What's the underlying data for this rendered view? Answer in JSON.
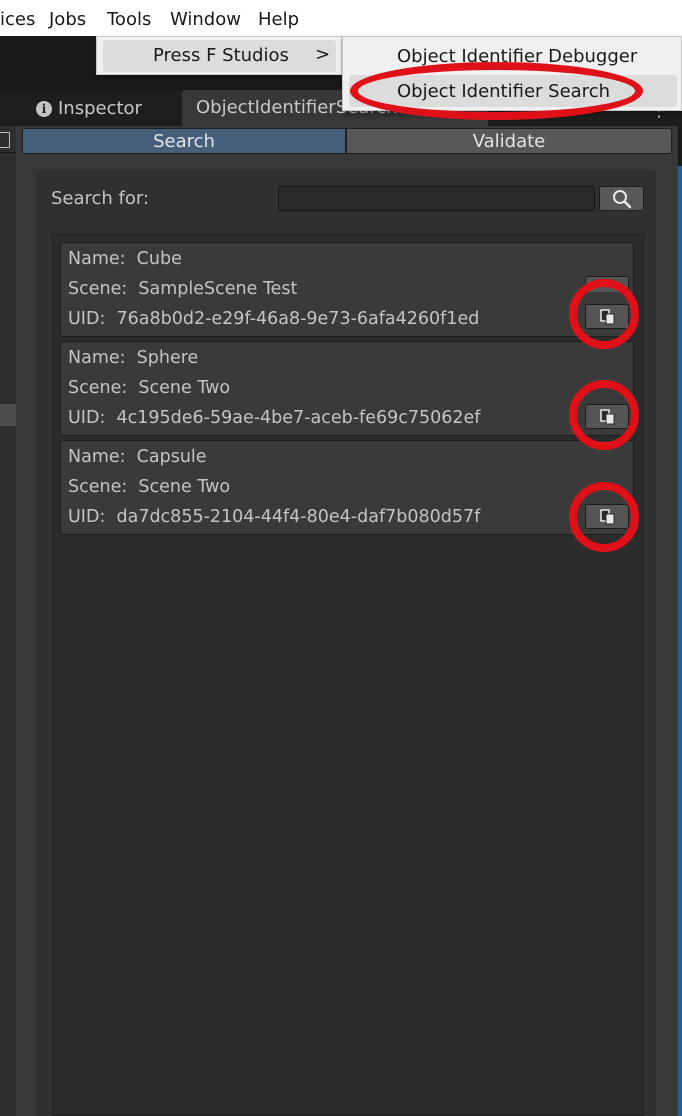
{
  "menubar": {
    "items": [
      "ices",
      "Jobs",
      "Tools",
      "Window",
      "Help"
    ]
  },
  "tools_menu": {
    "item": "Press F Studios",
    "arrow": ">"
  },
  "submenu": {
    "items": [
      "Object Identifier Debugger",
      "Object Identifier Search"
    ]
  },
  "tabs": {
    "inspector": "Inspector",
    "inspector_icon": "i",
    "ois": "ObjectIdentifierSearch",
    "more": "⋮"
  },
  "segments": {
    "search": "Search",
    "validate": "Validate"
  },
  "search": {
    "label": "Search for:",
    "value": "",
    "placeholder": ""
  },
  "results": [
    {
      "name_label": "Name:",
      "name": "Cube",
      "scene_label": "Scene:",
      "scene": "SampleScene Test",
      "uid_label": "UID:",
      "uid": "76a8b0d2-e29f-46a8-9e73-6afa4260f1ed"
    },
    {
      "name_label": "Name:",
      "name": "Sphere",
      "scene_label": "Scene:",
      "scene": "Scene Two",
      "uid_label": "UID:",
      "uid": "4c195de6-59ae-4be7-aceb-fe69c75062ef"
    },
    {
      "name_label": "Name:",
      "name": "Capsule",
      "scene_label": "Scene:",
      "scene": "Scene Two",
      "uid_label": "UID:",
      "uid": "da7dc855-2104-44f4-80e4-daf7b080d57f"
    }
  ],
  "icons": {
    "search_button": "search-icon",
    "copy_button": "copy-icon"
  },
  "colors": {
    "annotation_red": "#e01018",
    "search_segment": "#46607c",
    "panel": "#383838"
  }
}
